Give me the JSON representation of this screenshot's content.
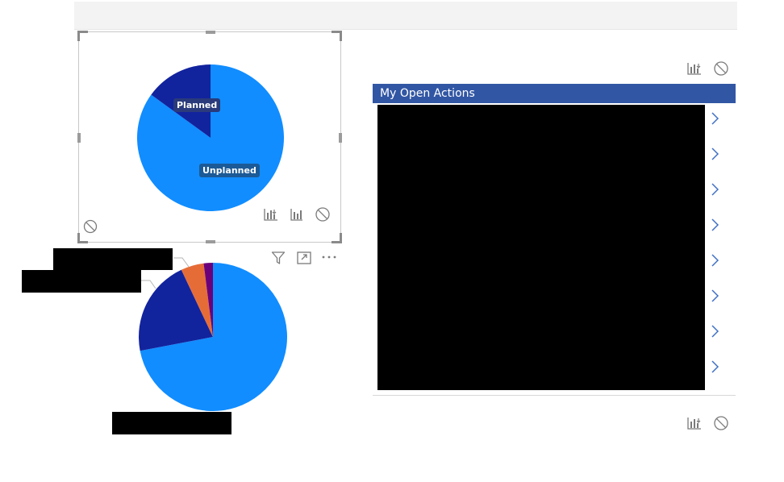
{
  "canvas": {
    "top_bar": ""
  },
  "pie_chart_1": {
    "labels": {
      "planned": "Planned",
      "unplanned": "Unplanned"
    },
    "chart_data": {
      "type": "pie",
      "categories": [
        "Unplanned",
        "Planned"
      ],
      "values": [
        85,
        15
      ],
      "colors": [
        "#118dff",
        "#12239e"
      ]
    },
    "header_icons": [
      "see-records-icon",
      "drill-icon",
      "no-filter-icon"
    ],
    "status_icon": "no-filter-icon",
    "selected": true
  },
  "pie_chart_2": {
    "header_icons": [
      "filter-icon",
      "focus-mode-icon",
      "more-options-icon"
    ],
    "chart_data": {
      "type": "pie",
      "categories": [
        "",
        "",
        "",
        ""
      ],
      "values": [
        72,
        21,
        5,
        2
      ],
      "colors": [
        "#118dff",
        "#12239e",
        "#e66c37",
        "#6b007b"
      ]
    },
    "redacted_labels": 3
  },
  "open_actions": {
    "title": "My Open Actions",
    "header_color": "#3156a4",
    "row_count": 8,
    "row_icon": "chevron-right-icon",
    "top_icons": [
      "see-records-icon",
      "no-filter-icon"
    ],
    "bottom_icons": [
      "see-records-icon",
      "no-filter-icon"
    ]
  }
}
